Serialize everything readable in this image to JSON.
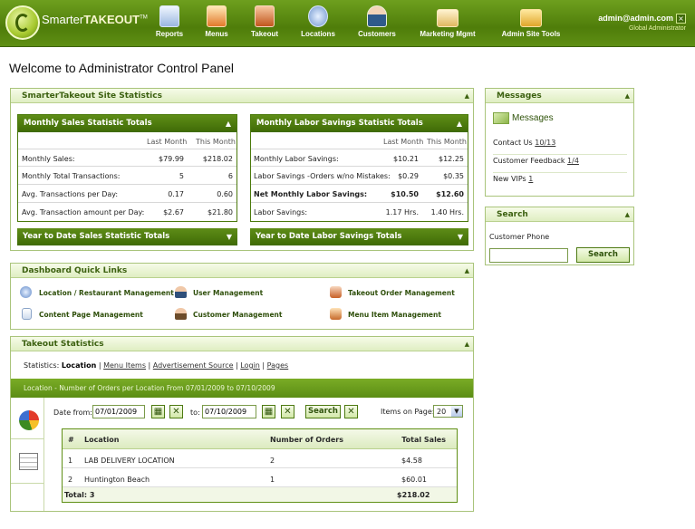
{
  "brand": {
    "name_a": "Smarter",
    "name_b": "TAKEOUT",
    "tm": "TM"
  },
  "nav": [
    {
      "label": "Reports",
      "icon": "reports-icon"
    },
    {
      "label": "Menus",
      "icon": "menus-icon"
    },
    {
      "label": "Takeout",
      "icon": "takeout-icon"
    },
    {
      "label": "Locations",
      "icon": "locations-icon"
    },
    {
      "label": "Customers",
      "icon": "customers-icon"
    },
    {
      "label": "Marketing Mgmt",
      "icon": "marketing-icon"
    },
    {
      "label": "Admin Site Tools",
      "icon": "folder-icon"
    }
  ],
  "user": {
    "email": "admin@admin.com",
    "role": "Global Administrator",
    "logout": "×"
  },
  "page_title": "Welcome to Administrator Control Panel",
  "site_stats": {
    "title": "SmarterTakeout Site Statistics",
    "sales": {
      "title": "Monthly Sales Statistic Totals",
      "col_last": "Last Month",
      "col_this": "This Month",
      "rows": [
        {
          "label": "Monthly Sales:",
          "last": "$79.99",
          "this": "$218.02"
        },
        {
          "label": "Monthly Total Transactions:",
          "last": "5",
          "this": "6"
        },
        {
          "label": "Avg. Transactions per Day:",
          "last": "0.17",
          "this": "0.60"
        },
        {
          "label": "Avg. Transaction amount per Day:",
          "last": "$2.67",
          "this": "$21.80"
        }
      ],
      "ytd": "Year to Date Sales Statistic Totals"
    },
    "labor": {
      "title": "Monthly Labor Savings Statistic Totals",
      "col_last": "Last Month",
      "col_this": "This Month",
      "rows": [
        {
          "label": "Monthly Labor Savings:",
          "last": "$10.21",
          "this": "$12.25"
        },
        {
          "label": "Labor Savings -Orders w/no Mistakes:",
          "last": "$0.29",
          "this": "$0.35"
        },
        {
          "label": "Net Monthly Labor Savings:",
          "last": "$10.50",
          "this": "$12.60"
        },
        {
          "label": "Labor Savings:",
          "last": "1.17 Hrs.",
          "this": "1.40 Hrs."
        }
      ],
      "ytd": "Year to Date Labor Savings Totals"
    }
  },
  "quick_links": {
    "title": "Dashboard Quick Links",
    "items": [
      {
        "label": "Location / Restaurant Management",
        "icon": "location-icon"
      },
      {
        "label": "User Management",
        "icon": "user-icon"
      },
      {
        "label": "Takeout Order Management",
        "icon": "takeout-box-icon"
      },
      {
        "label": "Content Page Management",
        "icon": "page-icon"
      },
      {
        "label": "Customer Management",
        "icon": "customer-icon"
      },
      {
        "label": "Menu Item Management",
        "icon": "menu-item-icon"
      }
    ]
  },
  "takeout": {
    "title": "Takeout Statistics",
    "stats_label": "Statistics:",
    "tabs": [
      "Location",
      "Menu Items",
      "Advertisement Source",
      "Login",
      "Pages"
    ],
    "banner": "Location - Number of Orders per Location From 07/01/2009 to 07/10/2009",
    "date_from_label": "Date from:",
    "date_from": "07/01/2009",
    "to_label": "to:",
    "date_to": "07/10/2009",
    "search": "Search",
    "items_label": "Items on Page:",
    "items_value": "20",
    "table": {
      "headers": [
        "#",
        "Location",
        "Number of Orders",
        "Total Sales"
      ],
      "rows": [
        [
          "1",
          "LAB DELIVERY LOCATION",
          "2",
          "$4.58"
        ],
        [
          "2",
          "Huntington Beach",
          "1",
          "$60.01"
        ]
      ],
      "total_label": "Total: 3",
      "total_sales": "$218.02"
    }
  },
  "messages": {
    "title": "Messages",
    "heading": "Messages",
    "rows": [
      {
        "label": "Contact Us",
        "value": "10/13"
      },
      {
        "label": "Customer Feedback",
        "value": "1/4"
      },
      {
        "label": "New VIPs",
        "value": "1"
      }
    ]
  },
  "search_panel": {
    "title": "Search",
    "label": "Customer Phone",
    "button": "Search"
  },
  "colors": {
    "brand_green": "#4f7d0a",
    "header_text": "#3c6110"
  }
}
